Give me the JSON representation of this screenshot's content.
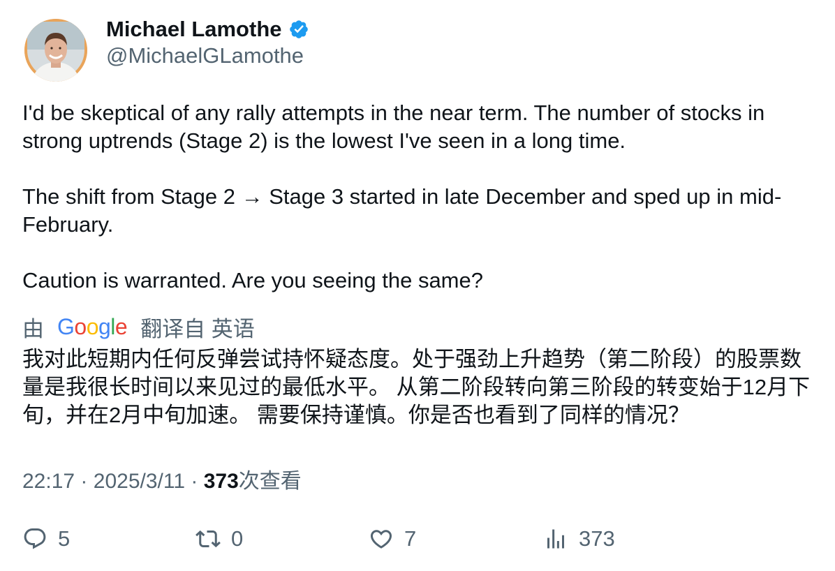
{
  "author": {
    "display_name": "Michael Lamothe",
    "handle": "@MichaelGLamothe",
    "verified_icon": "verified-badge-icon",
    "avatar_icon": "avatar-photo"
  },
  "tweet": {
    "paragraphs": [
      "I'd be skeptical of any rally attempts in the near term. The number of stocks in strong uptrends (Stage 2) is the lowest I've seen in a long time.",
      "The shift from Stage 2 → Stage 3 started in late December and sped up in mid-February.",
      "Caution is warranted. Are you seeing the same?"
    ]
  },
  "translation_bar": {
    "prefix": "由",
    "provider": "Google",
    "suffix": "翻译自 英语"
  },
  "translation_text": "我对此短期内任何反弹尝试持怀疑态度。处于强劲上升趋势（第二阶段）的股票数量是我很长时间以来见过的最低水平。 从第二阶段转向第三阶段的转变始于12月下旬，并在2月中旬加速。 需要保持谨慎。你是否也看到了同样的情况？",
  "meta": {
    "time": "22:17",
    "separator": "·",
    "date": "2025/3/11",
    "views_count": "373",
    "views_label": "次查看"
  },
  "actions": {
    "replies": "5",
    "retweets": "0",
    "likes": "7",
    "views": "373"
  },
  "colors": {
    "text_primary": "#0f1419",
    "text_secondary": "#536471",
    "verified_blue": "#1d9bf0",
    "google_blue": "#4285F4",
    "google_red": "#EA4335",
    "google_yellow": "#FBBC05",
    "google_green": "#34A853"
  }
}
